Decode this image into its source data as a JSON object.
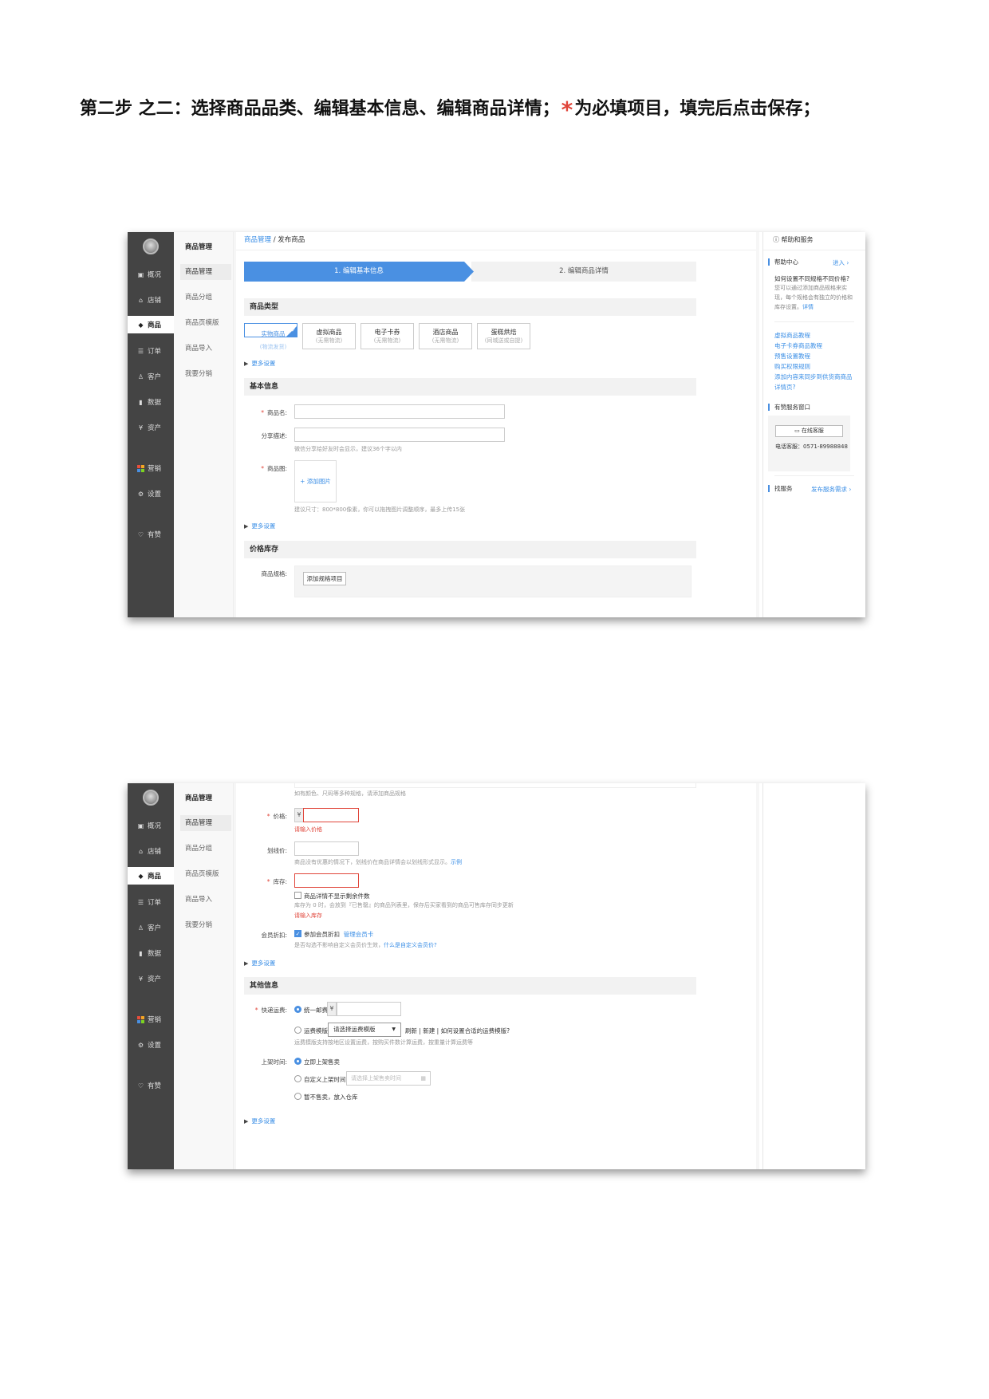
{
  "heading": {
    "before_star": "第二步 之二：选择商品品类、编辑基本信息、编辑商品详情；",
    "star": "*",
    "after_star": "为必填项目，填完后点击保存；"
  },
  "sidebar_dark": {
    "items": [
      {
        "label": "概况",
        "icon": "dashboard-icon"
      },
      {
        "label": "店铺",
        "icon": "store-icon"
      },
      {
        "label": "商品",
        "icon": "tag-icon"
      },
      {
        "label": "订单",
        "icon": "order-icon"
      },
      {
        "label": "客户",
        "icon": "user-icon"
      },
      {
        "label": "数据",
        "icon": "bar-chart-icon"
      },
      {
        "label": "资产",
        "icon": "yen-icon"
      },
      {
        "label": "营销",
        "icon": "apps-icon"
      },
      {
        "label": "设置",
        "icon": "gear-icon"
      },
      {
        "label": "有赞",
        "icon": "thumbs-up-icon"
      }
    ]
  },
  "submenu": {
    "title": "商品管理",
    "items": [
      "商品管理",
      "商品分组",
      "商品页模版",
      "商品导入",
      "我要分销"
    ]
  },
  "breadcrumb": {
    "parent": "商品管理",
    "sep": " / ",
    "current": "发布商品"
  },
  "steps": [
    "1. 编辑基本信息",
    "2. 编辑商品详情"
  ],
  "sections": {
    "type": "商品类型",
    "basic": "基本信息",
    "stock": "价格库存",
    "other": "其他信息"
  },
  "product_types": [
    {
      "title": "实物商品",
      "sub": "(物流发货)"
    },
    {
      "title": "虚拟商品",
      "sub": "(无需物流)"
    },
    {
      "title": "电子卡券",
      "sub": "(无需物流)"
    },
    {
      "title": "酒店商品",
      "sub": "(无需物流)"
    },
    {
      "title": "蛋糕烘焙",
      "sub": "(同城送或自提)"
    }
  ],
  "more_settings": "更多设置",
  "form": {
    "name_label": "商品名:",
    "share_label": "分享描述:",
    "share_hint": "微信分享给好友时会显示，建议36个字以内",
    "image_label": "商品图:",
    "add_image": "+ 添加图片",
    "image_hint": "建议尺寸：800*800像素，你可以拖拽图片调整顺序，最多上传15张",
    "spec_label": "商品规格:",
    "add_spec": "添加规格项目",
    "spec_hint": "如有颜色、尺码等多种规格，请添加商品规格",
    "price_label": "价格:",
    "currency": "¥",
    "price_error": "请输入价格",
    "strike_label": "划线价:",
    "strike_hint": "商品没有优惠的情况下，划线价在商品详情会以划线形式显示。",
    "example": "示例",
    "stock_label": "库存:",
    "hide_stock": "商品详情不显示剩余件数",
    "stock_hint": "库存为 0 时，会放到『已售罄』的商品列表里，保存后买家看到的商品可售库存同步更新",
    "stock_error": "请输入库存",
    "member_label": "会员折扣:",
    "member_join": "参加会员折扣",
    "member_manage": "管理会员卡",
    "member_hint": "是否勾选不影响自定义会员价生效，",
    "member_link": "什么是自定义会员价?",
    "ship_label": "快递运费:",
    "ship_unified": "统一邮费",
    "ship_template": "运费模版",
    "ship_select": "请选择运费模版",
    "ship_refresh": "刷新",
    "ship_new": "新建",
    "ship_howto": "如何设置合适的运费模版?",
    "ship_divider": " | ",
    "ship_hint": "运费模版支持按地区设置运费，按购买件数计算运费，按重量计算运费等",
    "shelf_label": "上架时间:",
    "shelf_now": "立即上架售卖",
    "shelf_custom": "自定义上架时间",
    "shelf_placeholder": "请选择上架售卖时间",
    "shelf_none": "暂不售卖，放入仓库"
  },
  "help": {
    "title": "帮助和服务",
    "center": "帮助中心",
    "enter": "进入 ›",
    "question": "如何设置不同规格不同价格?",
    "answer": "您可以通过添加商品规格来实现，每个规格会有独立的价格和库存设置。",
    "detail": "详情",
    "links": [
      "虚拟商品教程",
      "电子卡券商品教程",
      "预售设置教程",
      "购买权限规则",
      "添加内容来同步到供货商商品",
      "详情页?"
    ],
    "service_window": "有赞服务窗口",
    "online_service": "在线客服",
    "phone": "电话客服：0571-89988848",
    "find_service": "找服务",
    "post_demand": "发布服务需求 ›"
  },
  "colors": {
    "accent": "#4a90e2",
    "required": "#e0453a",
    "dark_sidebar": "#444444"
  }
}
